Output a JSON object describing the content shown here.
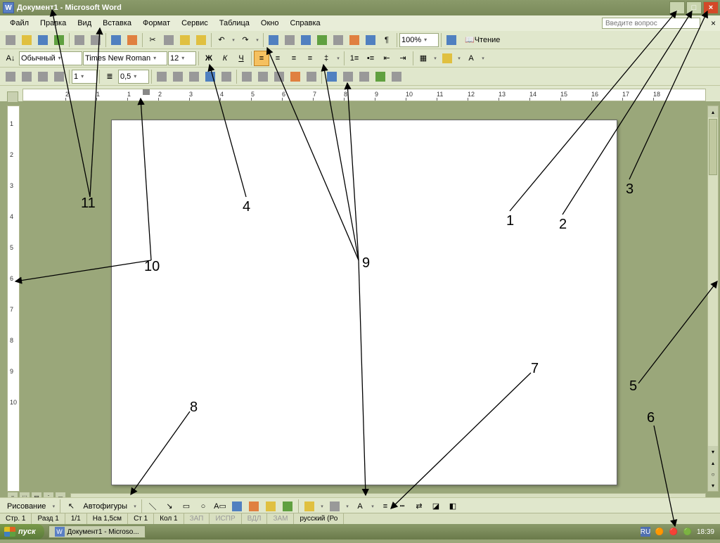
{
  "title": "Документ1 - Microsoft Word",
  "menu": [
    "Файл",
    "Правка",
    "Вид",
    "Вставка",
    "Формат",
    "Сервис",
    "Таблица",
    "Окно",
    "Справка"
  ],
  "ask_placeholder": "Введите вопрос",
  "toolbars": {
    "zoom": "100%",
    "reading": "Чтение",
    "style": "Обычный",
    "font": "Times New Roman",
    "size": "12",
    "spacing": "0,5",
    "page_num": "1"
  },
  "formatting": {
    "bold": "Ж",
    "italic": "К",
    "underline": "Ч"
  },
  "drawing": {
    "label": "Рисование",
    "autoshapes": "Автофигуры"
  },
  "status": {
    "page": "Стр. 1",
    "section": "Разд 1",
    "pages": "1/1",
    "at": "На 1,5см",
    "line": "Ст 1",
    "col": "Кол 1",
    "rec": "ЗАП",
    "trk": "ИСПР",
    "ext": "ВДЛ",
    "ovr": "ЗАМ",
    "lang": "русский (Ро"
  },
  "ruler_h": [
    "2",
    "1",
    "1",
    "2",
    "3",
    "4",
    "5",
    "6",
    "7",
    "8",
    "9",
    "10",
    "11",
    "12",
    "13",
    "14",
    "15",
    "16",
    "17",
    "18"
  ],
  "ruler_v": [
    "1",
    "2",
    "3",
    "4",
    "5",
    "6",
    "7",
    "8",
    "9",
    "10"
  ],
  "taskbar": {
    "start": "пуск",
    "task": "Документ1 - Microso...",
    "lang": "RU",
    "time": "18:39"
  },
  "annotations": {
    "n1": "1",
    "n2": "2",
    "n3": "3",
    "n4": "4",
    "n5": "5",
    "n6": "6",
    "n7": "7",
    "n8": "8",
    "n9": "9",
    "n10": "10",
    "n11": "11"
  }
}
